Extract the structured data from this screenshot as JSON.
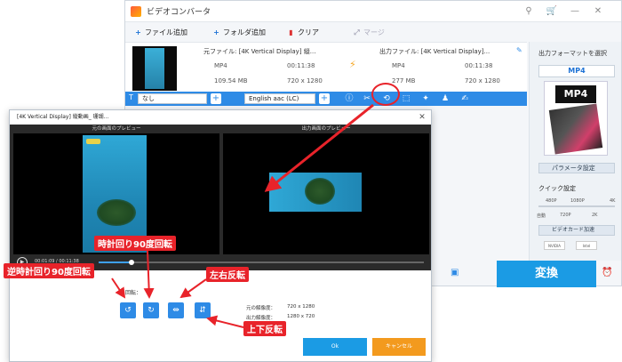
{
  "converter": {
    "title": "ビデオコンバータ",
    "window_buttons": [
      "⚲",
      "🛒",
      "—",
      "✕"
    ],
    "toolbar": {
      "add_file": "ファイル追加",
      "add_folder": "フォルダ追加",
      "clear": "クリア",
      "merge": "マージ"
    },
    "source": {
      "label": "元ファイル: [4K Vertical Display] 縦...",
      "format": "MP4",
      "duration": "00:11:38",
      "size": "109.54 MB",
      "resolution": "720 x 1280"
    },
    "output": {
      "label": "出力ファイル: [4K Vertical Display]...",
      "format": "MP4",
      "duration": "00:11:38",
      "size": "277 MB",
      "resolution": "720 x 1280"
    },
    "subtitle_select": "なし",
    "audio_select": "English aac (LC)",
    "sidebar": {
      "select_format": "出力フォーマットを選択",
      "format": "MP4",
      "format_box_label": "MP4",
      "param_settings": "パラメータ設定",
      "quick_settings": "クイック設定",
      "quality_top": [
        "480P",
        "1080P",
        "4K"
      ],
      "quality_bottom": [
        "自動",
        "720P",
        "2K"
      ],
      "gpu_accel": "ビデオカード加速",
      "chips": [
        "NVIDIA",
        "Intel"
      ]
    },
    "convert_button": "変換"
  },
  "dialog": {
    "title": "[4K Vertical Display] 縦動画_ 珊瑚...",
    "source_preview": "元の画面のプレビュー",
    "output_preview": "出力画面のプレビュー",
    "time": "00:01:09 / 00:11:38",
    "seek_progress": 0.1,
    "rotate_label": "回転：",
    "src_resolution_label": "元の解像度：",
    "src_resolution": "720 x 1280",
    "out_resolution_label": "出力解像度：",
    "out_resolution": "1280 x 720",
    "ok": "Ok",
    "cancel": "キャンセル"
  },
  "callouts": {
    "ccw": "逆時計回り90度回転",
    "cw": "時計回り90度回転",
    "mirror_h": "左右反転",
    "mirror_v": "上下反転"
  },
  "colors": {
    "accent": "#2e8be6",
    "callout": "#e8232a",
    "convert": "#1b9be4",
    "cancel": "#f39a1e"
  }
}
